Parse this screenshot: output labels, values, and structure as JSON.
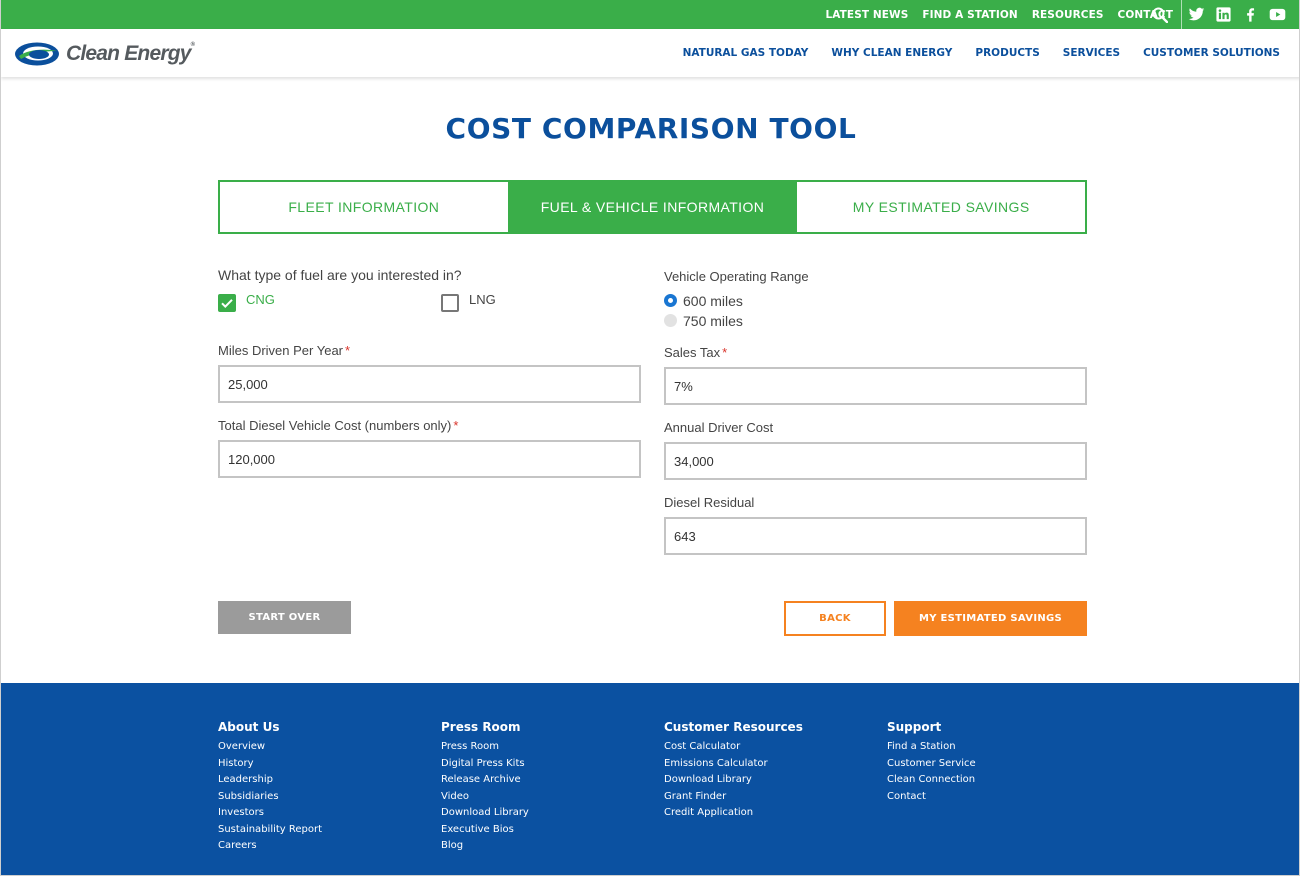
{
  "topbar": {
    "links": [
      "LATEST NEWS",
      "FIND A STATION",
      "RESOURCES",
      "CONTACT"
    ],
    "icons": [
      "search-icon",
      "twitter-icon",
      "linkedin-icon",
      "facebook-icon",
      "youtube-icon"
    ]
  },
  "header": {
    "logo_text": "Clean Energy",
    "nav": [
      "NATURAL GAS TODAY",
      "WHY CLEAN ENERGY",
      "PRODUCTS",
      "SERVICES",
      "CUSTOMER SOLUTIONS"
    ]
  },
  "page": {
    "title": "COST COMPARISON TOOL"
  },
  "tabs": [
    {
      "label": "FLEET INFORMATION",
      "active": false
    },
    {
      "label": "FUEL & VEHICLE INFORMATION",
      "active": true
    },
    {
      "label": "MY ESTIMATED SAVINGS",
      "active": false
    }
  ],
  "form": {
    "fuel_question": "What type of fuel are you interested in?",
    "fuel_options": [
      {
        "label": "CNG",
        "checked": true
      },
      {
        "label": "LNG",
        "checked": false
      }
    ],
    "miles_label": "Miles Driven Per Year",
    "miles_value": "25,000",
    "diesel_cost_label": "Total Diesel Vehicle Cost (numbers only)",
    "diesel_cost_value": "120,000",
    "range_label": "Vehicle Operating Range",
    "range_options": [
      {
        "label": "600 miles",
        "selected": true
      },
      {
        "label": "750 miles",
        "selected": false
      }
    ],
    "sales_tax_label": "Sales Tax",
    "sales_tax_value": "7%",
    "driver_cost_label": "Annual Driver Cost",
    "driver_cost_value": "34,000",
    "residual_label": "Diesel Residual",
    "residual_value": "643",
    "required_mark": "*"
  },
  "buttons": {
    "start_over": "START OVER",
    "back": "BACK",
    "savings": "MY ESTIMATED SAVINGS"
  },
  "footer": {
    "columns": [
      {
        "heading": "About Us",
        "links": [
          "Overview",
          "History",
          "Leadership",
          "Subsidiaries",
          "Investors",
          "Sustainability Report",
          "Careers"
        ]
      },
      {
        "heading": "Press Room",
        "links": [
          "Press Room",
          "Digital Press Kits",
          "Release Archive",
          "Video",
          "Download Library",
          "Executive Bios",
          "Blog"
        ]
      },
      {
        "heading": "Customer Resources",
        "links": [
          "Cost Calculator",
          "Emissions Calculator",
          "Download Library",
          "Grant Finder",
          "Credit Application"
        ]
      },
      {
        "heading": "Support",
        "links": [
          "Find a Station",
          "Customer Service",
          "Clean Connection",
          "Contact"
        ]
      }
    ]
  },
  "colors": {
    "green": "#3aae49",
    "blue": "#0b4f9c",
    "orange": "#f58220",
    "footer_blue": "#0b51a1"
  }
}
